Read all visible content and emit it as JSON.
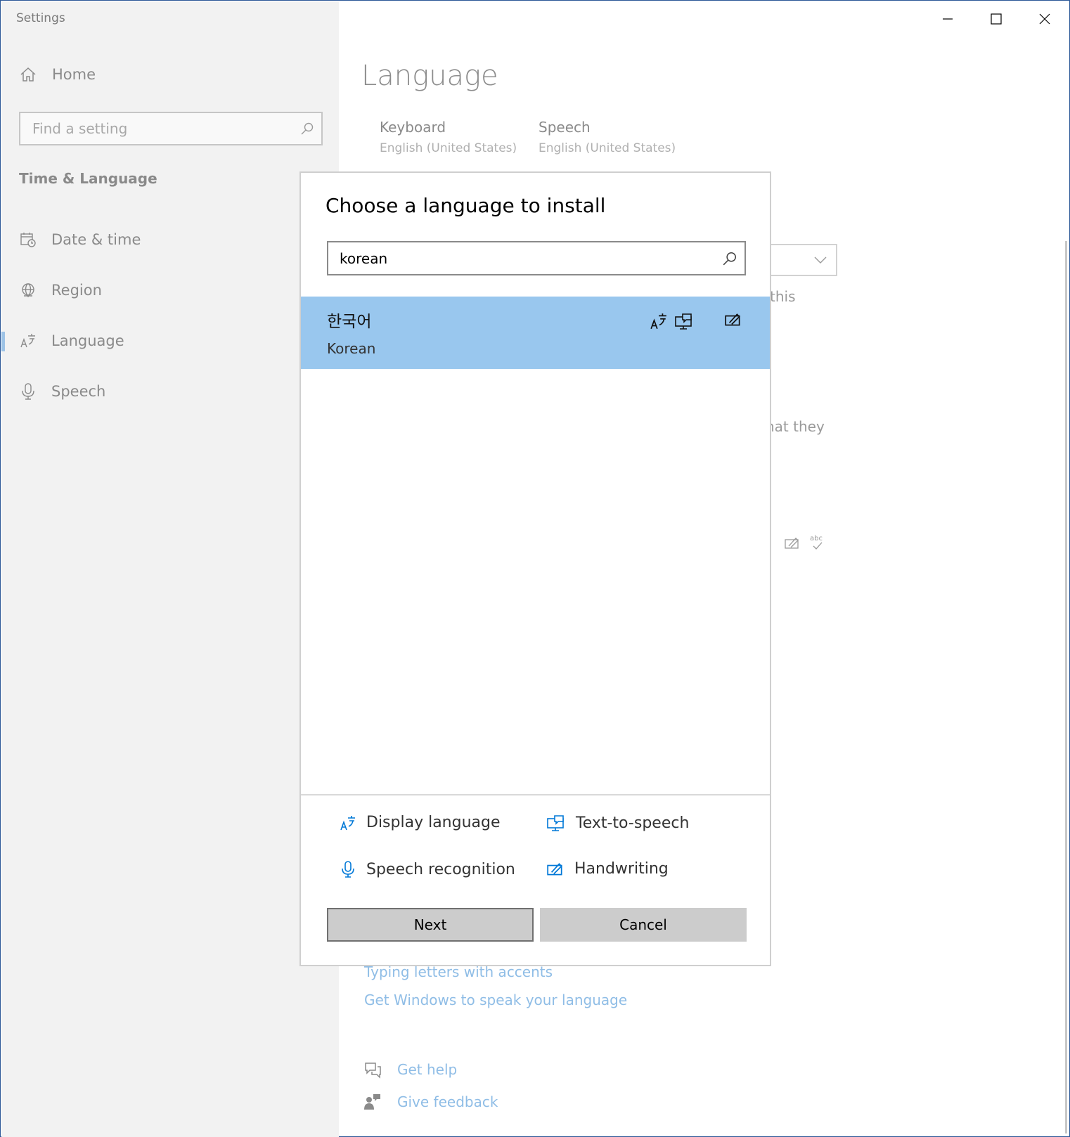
{
  "window": {
    "title": "Settings"
  },
  "sidebar": {
    "home_label": "Home",
    "search_placeholder": "Find a setting",
    "section_title": "Time & Language",
    "items": [
      {
        "label": "Date & time",
        "icon": "calendar-clock-icon",
        "selected": false
      },
      {
        "label": "Region",
        "icon": "globe-icon",
        "selected": false
      },
      {
        "label": "Language",
        "icon": "language-icon",
        "selected": true
      },
      {
        "label": "Speech",
        "icon": "microphone-icon",
        "selected": false
      }
    ]
  },
  "main": {
    "page_title": "Language",
    "tiles": [
      {
        "title": "Keyboard",
        "subtitle": "English (United States)"
      },
      {
        "title": "Speech",
        "subtitle": "English (United States)"
      }
    ],
    "partial_text": [
      "this",
      "nat they"
    ],
    "links": [
      "Typing letters with accents",
      "Get Windows to speak your language"
    ],
    "help": {
      "get_help": "Get help",
      "give_feedback": "Give feedback"
    }
  },
  "dialog": {
    "title": "Choose a language to install",
    "search_value": "korean",
    "results": [
      {
        "native": "한국어",
        "english": "Korean",
        "features": [
          "display-language-icon",
          "text-to-speech-icon",
          "handwriting-icon"
        ],
        "selected": true
      }
    ],
    "legend": {
      "display_language": "Display language",
      "text_to_speech": "Text-to-speech",
      "speech_recognition": "Speech recognition",
      "handwriting": "Handwriting"
    },
    "buttons": {
      "next": "Next",
      "cancel": "Cancel"
    }
  },
  "colors": {
    "accent": "#0078d7",
    "selection": "#99c7ee",
    "link": "#8fbde6"
  }
}
